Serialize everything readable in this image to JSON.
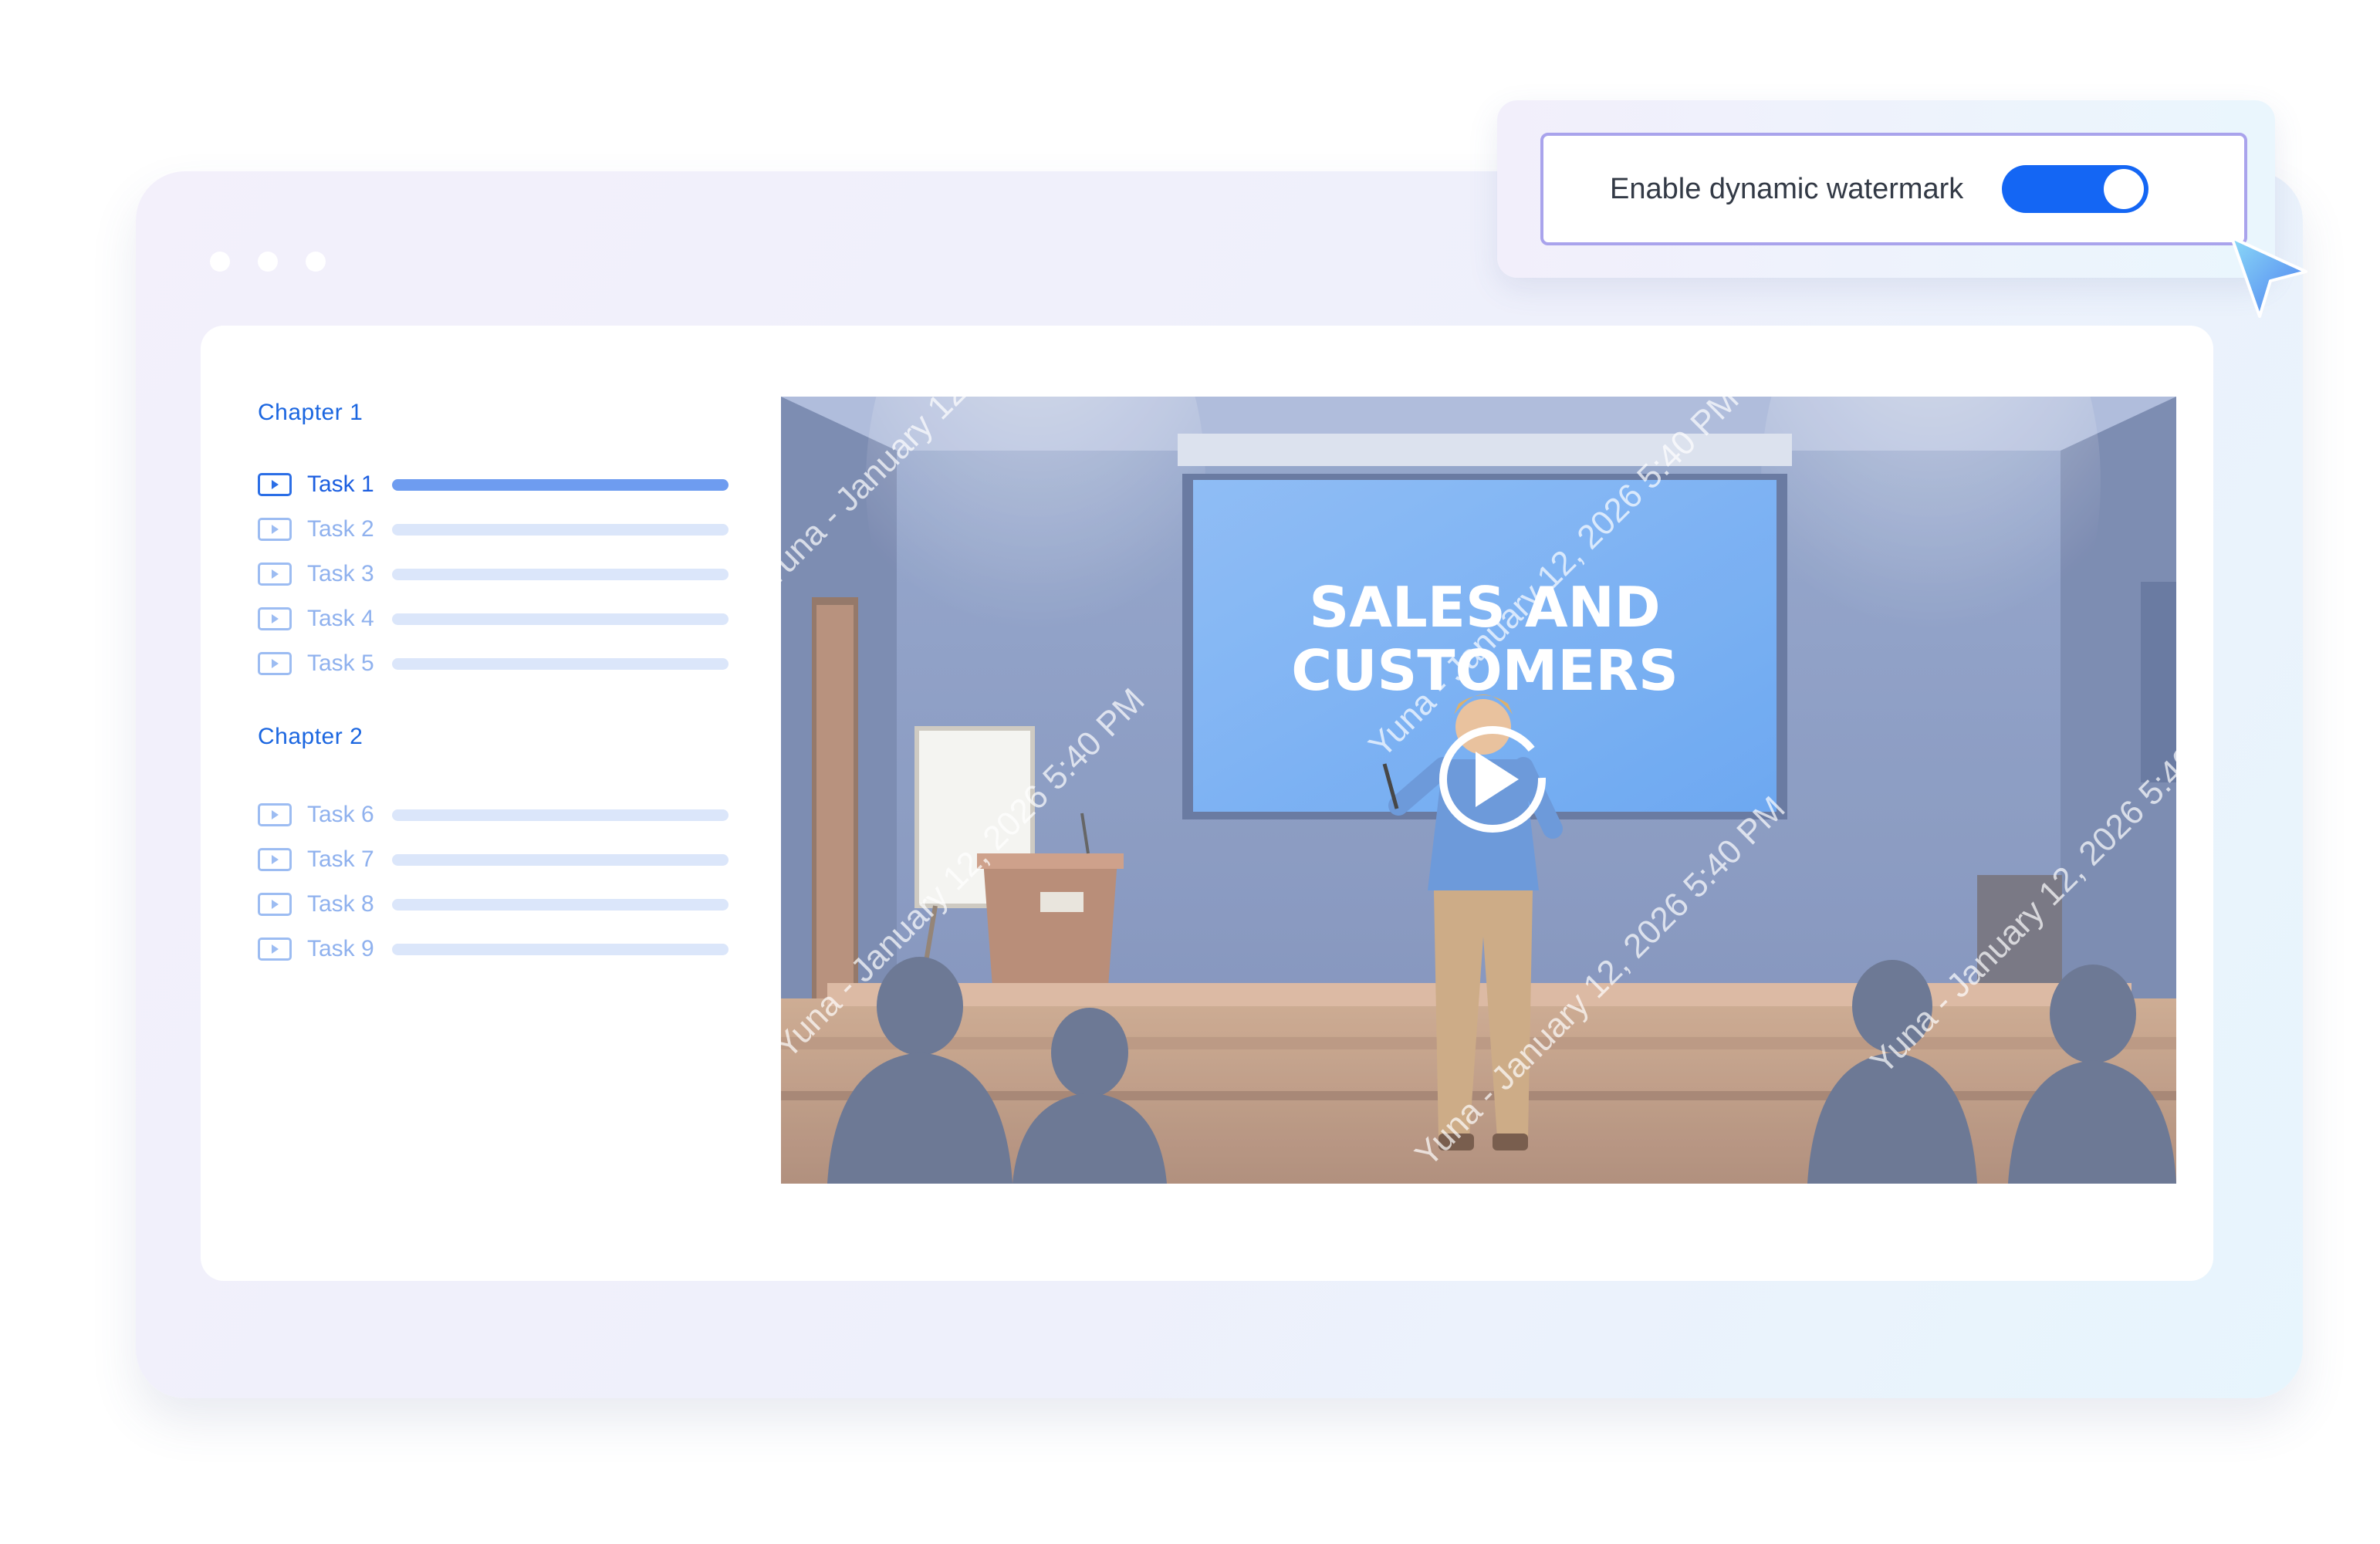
{
  "toggle_panel": {
    "label": "Enable dynamic watermark",
    "enabled": true,
    "accent_color": "#1466f4"
  },
  "sidebar": {
    "chapters": [
      {
        "title": "Chapter  1",
        "tasks": [
          {
            "label": "Task  1",
            "active": true,
            "progress": 1.0
          },
          {
            "label": "Task  2",
            "active": false
          },
          {
            "label": "Task  3",
            "active": false
          },
          {
            "label": "Task  4",
            "active": false
          },
          {
            "label": "Task  5",
            "active": false
          }
        ]
      },
      {
        "title": "Chapter  2",
        "tasks": [
          {
            "label": "Task  6",
            "active": false
          },
          {
            "label": "Task  7",
            "active": false
          },
          {
            "label": "Task  8",
            "active": false
          },
          {
            "label": "Task  9",
            "active": false
          }
        ]
      }
    ],
    "task_icon": "video-play-icon"
  },
  "video": {
    "screen_text_line1": "SALES AND",
    "screen_text_line2": "CUSTOMERS",
    "watermark_text": "Yuna - January 12, 2026 5:40 PM",
    "play_icon": "play-circle-icon"
  },
  "colors": {
    "chapter_text": "#1b66e0",
    "active_bar": "#6e9cf0",
    "inactive_bar": "#dbe6fa"
  }
}
